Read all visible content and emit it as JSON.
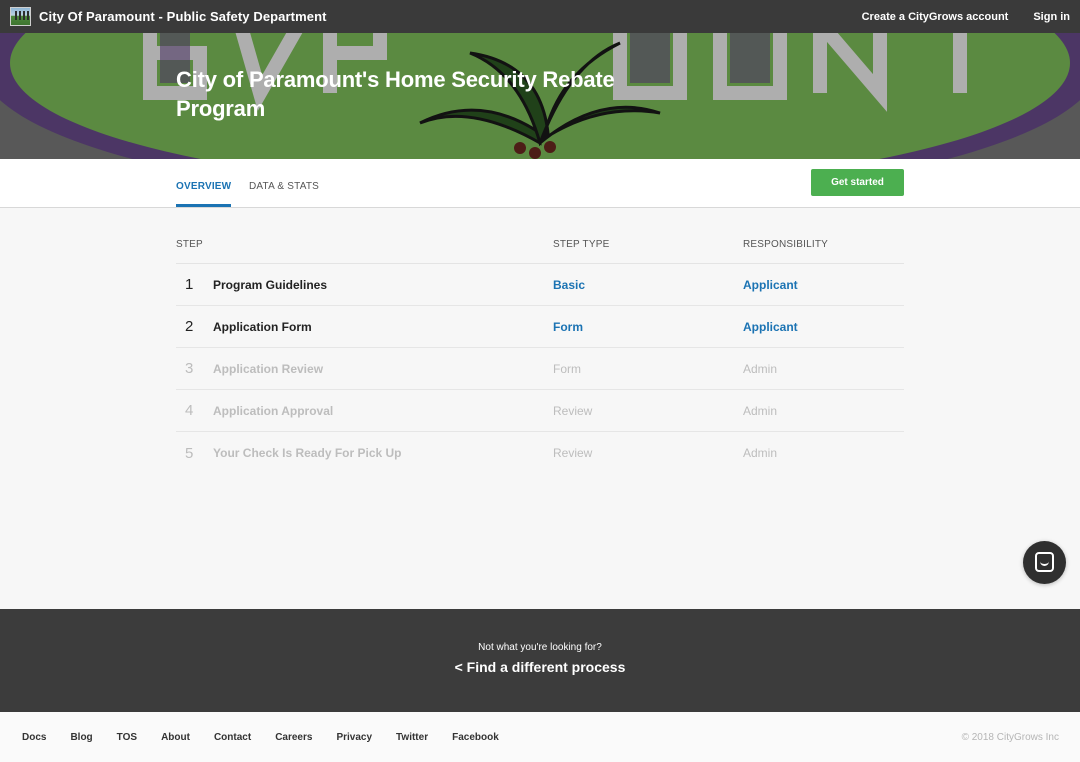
{
  "header": {
    "title": "City Of Paramount - Public Safety Department",
    "create_account": "Create a CityGrows account",
    "sign_in": "Sign in"
  },
  "hero": {
    "title": "City of Paramount's Home Security Rebate Program"
  },
  "tabs": [
    {
      "label": "OVERVIEW",
      "active": true
    },
    {
      "label": "DATA & STATS",
      "active": false
    }
  ],
  "get_started": "Get started",
  "table": {
    "headers": {
      "step": "STEP",
      "step_type": "STEP TYPE",
      "responsibility": "RESPONSIBILITY"
    },
    "rows": [
      {
        "num": "1",
        "name": "Program Guidelines",
        "type": "Basic",
        "resp": "Applicant",
        "active": true
      },
      {
        "num": "2",
        "name": "Application Form",
        "type": "Form",
        "resp": "Applicant",
        "active": true
      },
      {
        "num": "3",
        "name": "Application Review",
        "type": "Form",
        "resp": "Admin",
        "active": false
      },
      {
        "num": "4",
        "name": "Application Approval",
        "type": "Review",
        "resp": "Admin",
        "active": false
      },
      {
        "num": "5",
        "name": "Your Check Is Ready For Pick Up",
        "type": "Review",
        "resp": "Admin",
        "active": false
      }
    ]
  },
  "cta": {
    "subtitle": "Not what you're looking for?",
    "link": "< Find a different process"
  },
  "footer": {
    "links": [
      "Docs",
      "Blog",
      "TOS",
      "About",
      "Contact",
      "Careers",
      "Privacy",
      "Twitter",
      "Facebook"
    ],
    "copyright": "© 2018 CityGrows Inc"
  },
  "colors": {
    "accent": "#1b73b3",
    "button": "#4caf50",
    "topbar": "#3a3a3a"
  }
}
